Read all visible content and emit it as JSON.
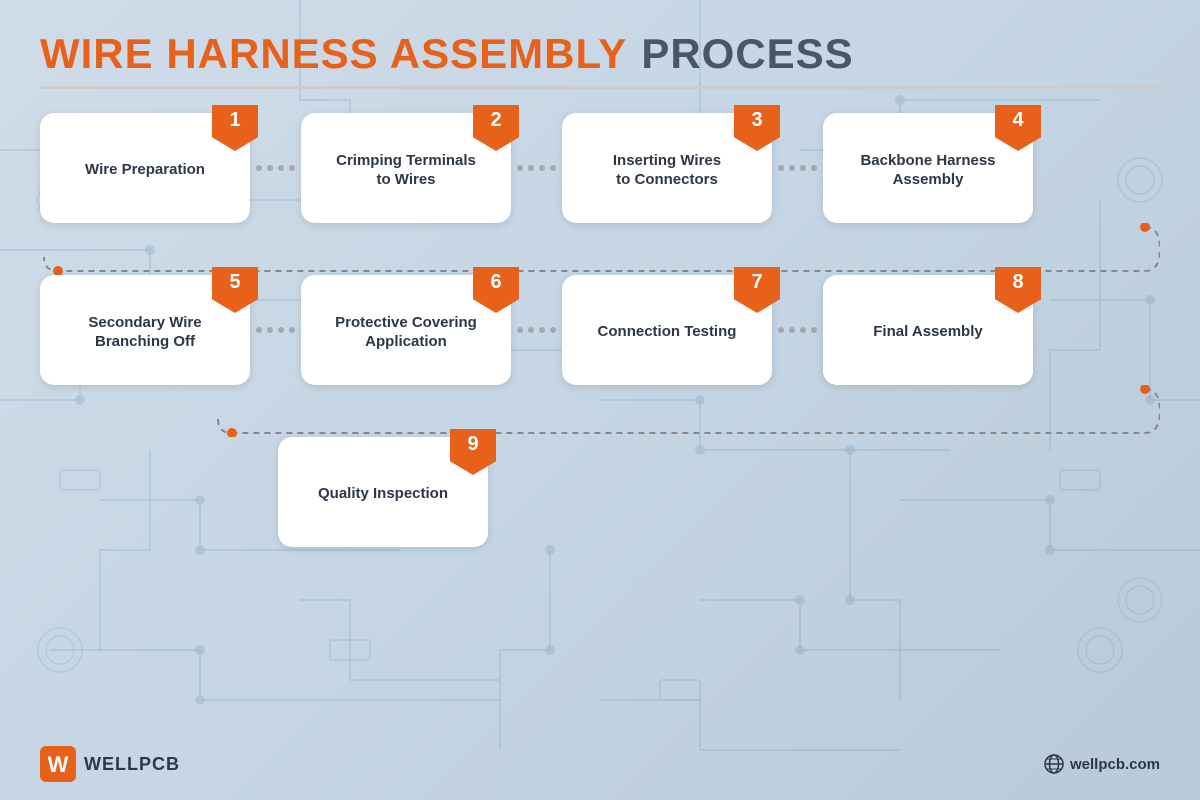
{
  "title": {
    "part1": "WIRE HARNESS ASSEMBLY",
    "part2": "PROCESS"
  },
  "steps": [
    {
      "number": "1",
      "label": "Wire Preparation"
    },
    {
      "number": "2",
      "label": "Crimping Terminals\nto Wires"
    },
    {
      "number": "3",
      "label": "Inserting Wires\nto Connectors"
    },
    {
      "number": "4",
      "label": "Backbone Harness\nAssembly"
    },
    {
      "number": "5",
      "label": "Secondary Wire\nBranching Off"
    },
    {
      "number": "6",
      "label": "Protective Covering\nApplication"
    },
    {
      "number": "7",
      "label": "Connection Testing"
    },
    {
      "number": "8",
      "label": "Final Assembly"
    },
    {
      "number": "9",
      "label": "Quality Inspection"
    }
  ],
  "footer": {
    "logo_text": "WELLPCB",
    "website": "wellpcb.com"
  }
}
